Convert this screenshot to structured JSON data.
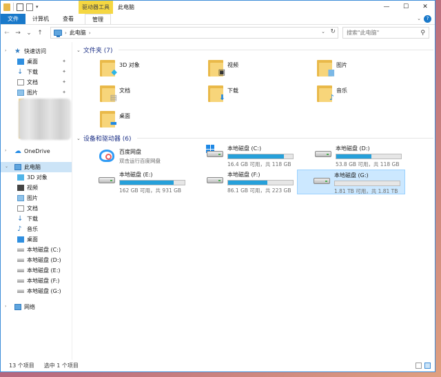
{
  "titlebar": {
    "context_tab": "驱动器工具",
    "title": "此电脑",
    "minimize": "—",
    "maximize": "☐",
    "close": "✕"
  },
  "ribbon": {
    "tabs": [
      "文件",
      "计算机",
      "查看",
      "管理"
    ],
    "help": "?"
  },
  "address": {
    "back": "←",
    "forward": "→",
    "recent": "⌄",
    "up": "↑",
    "path": "此电脑",
    "search_placeholder": "搜索\"此电脑\""
  },
  "nav_pane": {
    "quick_access": "快速访问",
    "pinned": [
      "桌面",
      "下载",
      "文档",
      "图片"
    ],
    "onedrive": "OneDrive",
    "this_pc": "此电脑",
    "pc_items": [
      "3D 对象",
      "视频",
      "图片",
      "文档",
      "下载",
      "音乐",
      "桌面",
      "本地磁盘 (C:)",
      "本地磁盘 (D:)",
      "本地磁盘 (E:)",
      "本地磁盘 (F:)",
      "本地磁盘 (G:)"
    ],
    "network": "网络"
  },
  "folders_group": {
    "header": "文件夹 (7)",
    "items": [
      {
        "name": "3D 对象",
        "icon": "3d-objects-icon"
      },
      {
        "name": "视频",
        "icon": "video-icon"
      },
      {
        "name": "图片",
        "icon": "pictures-icon"
      },
      {
        "name": "文档",
        "icon": "documents-icon"
      },
      {
        "name": "下载",
        "icon": "downloads-icon"
      },
      {
        "name": "音乐",
        "icon": "music-icon"
      },
      {
        "name": "桌面",
        "icon": "desktop-icon"
      }
    ]
  },
  "devices_group": {
    "header": "设备和驱动器 (6)",
    "baidu": {
      "name": "百度网盘",
      "sub": "双击运行百度网盘"
    },
    "drives": [
      {
        "name": "本地磁盘 (C:)",
        "sub": "16.4 GB 可用，共 118 GB",
        "used": 0.86
      },
      {
        "name": "本地磁盘 (D:)",
        "sub": "53.8 GB 可用，共 118 GB",
        "used": 0.54
      },
      {
        "name": "本地磁盘 (E:)",
        "sub": "162 GB 可用，共 931 GB",
        "used": 0.83
      },
      {
        "name": "本地磁盘 (F:)",
        "sub": "86.1 GB 可用，共 223 GB",
        "used": 0.61
      },
      {
        "name": "本地磁盘 (G:)",
        "sub": "1.81 TB 可用，共 1.81 TB",
        "used": 0.0
      }
    ]
  },
  "status": {
    "count": "13 个项目",
    "selected": "选中 1 个项目"
  },
  "colors": {
    "accent": "#1979ca",
    "bar_fill": "#26a0da",
    "selection": "#cce8ff",
    "context_tab": "#f5d742",
    "group_header": "#1e3287"
  }
}
